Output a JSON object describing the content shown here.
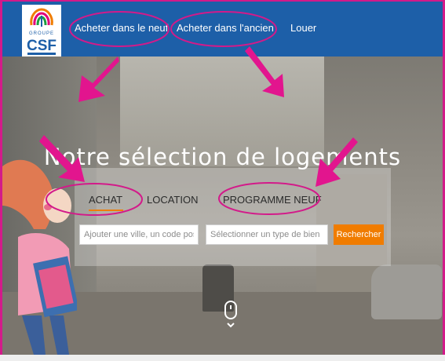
{
  "header": {
    "logo": {
      "text_top": "GROUPE",
      "text_main": "CSF",
      "icon": "csf-tree-logo"
    },
    "nav": [
      {
        "label": "Acheter dans le neuf"
      },
      {
        "label": "Acheter dans l'ancien"
      },
      {
        "label": "Louer"
      }
    ]
  },
  "hero": {
    "title": "Notre sélection de logements",
    "tabs": [
      {
        "label": "ACHAT",
        "active": true
      },
      {
        "label": "LOCATION",
        "active": false
      },
      {
        "label": "PROGRAMME NEUF",
        "active": false
      }
    ],
    "search": {
      "location_placeholder": "Ajouter une ville, un code postal",
      "type_placeholder": "Sélectionner un type de bien",
      "button_label": "Rechercher"
    },
    "scroll_icon": "mouse-scroll-icon"
  },
  "colors": {
    "header_bg": "#1d5fa8",
    "accent": "#f07c00",
    "annotation": "#d31a8a"
  }
}
